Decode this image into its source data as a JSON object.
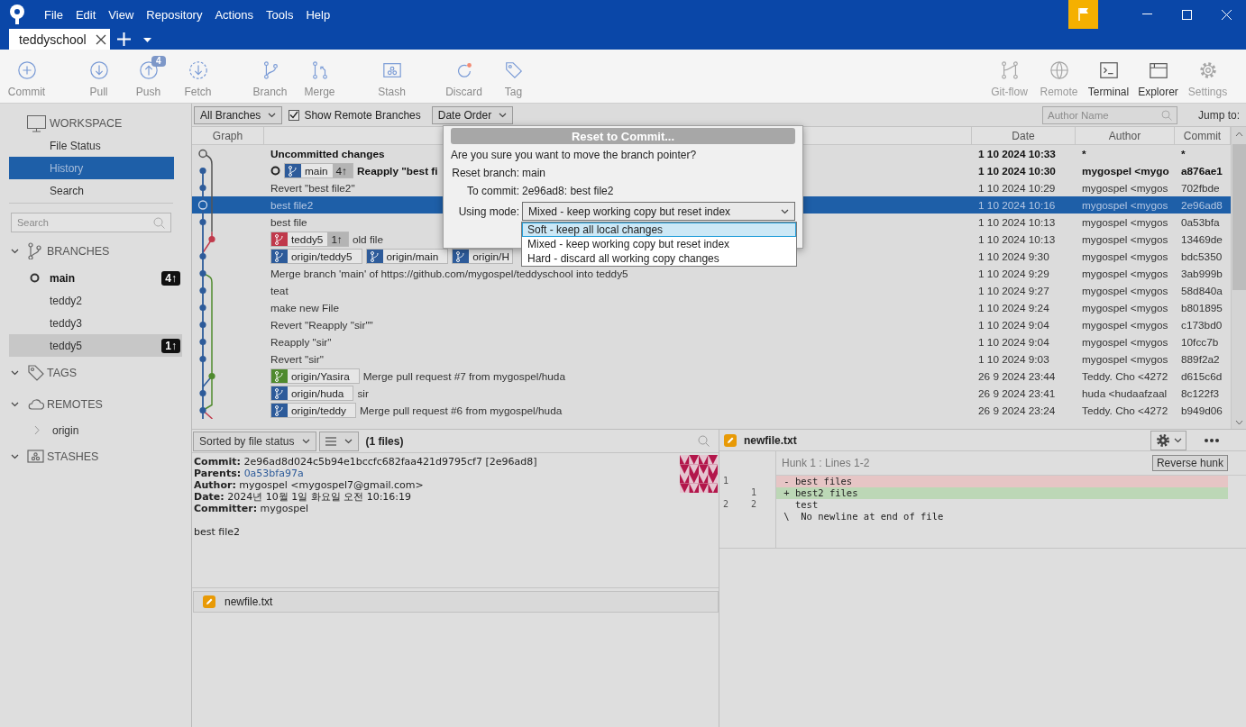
{
  "app": {
    "menu": [
      "File",
      "Edit",
      "View",
      "Repository",
      "Actions",
      "Tools",
      "Help"
    ]
  },
  "tabs": [
    {
      "label": "teddyschool",
      "selected": true
    }
  ],
  "toolbar": {
    "groups": [
      [
        {
          "label": "Commit",
          "kind": "commit"
        }
      ],
      [
        {
          "label": "Pull",
          "kind": "pull"
        },
        {
          "label": "Push",
          "kind": "push",
          "badge": "4"
        },
        {
          "label": "Fetch",
          "kind": "fetch"
        }
      ],
      [
        {
          "label": "Branch",
          "kind": "branch"
        },
        {
          "label": "Merge",
          "kind": "merge"
        }
      ],
      [
        {
          "label": "Stash",
          "kind": "stash"
        }
      ],
      [
        {
          "label": "Discard",
          "kind": "discard"
        },
        {
          "label": "Tag",
          "kind": "tag"
        }
      ]
    ],
    "right": [
      {
        "label": "Git-flow",
        "kind": "gitflow",
        "disabled": true
      },
      {
        "label": "Remote",
        "kind": "remote",
        "disabled": true
      },
      {
        "label": "Terminal",
        "kind": "terminal",
        "disabled": false
      },
      {
        "label": "Explorer",
        "kind": "explorer",
        "disabled": false
      },
      {
        "label": "Settings",
        "kind": "settings",
        "disabled": true
      }
    ]
  },
  "sidebar": {
    "workspace": {
      "title": "WORKSPACE",
      "items": [
        {
          "label": "File Status",
          "selected": false
        },
        {
          "label": "History",
          "selected": true
        },
        {
          "label": "Search",
          "selected": false
        }
      ]
    },
    "search": {
      "placeholder": "Search"
    },
    "sections": [
      {
        "title": "BRANCHES",
        "kind": "branches",
        "items": [
          {
            "label": "main",
            "current": true,
            "selected": false,
            "badge": "4↑"
          },
          {
            "label": "teddy2",
            "current": false,
            "selected": false
          },
          {
            "label": "teddy3",
            "current": false,
            "selected": false
          },
          {
            "label": "teddy5",
            "current": false,
            "selected": true,
            "badge": "1↑"
          }
        ]
      },
      {
        "title": "TAGS",
        "kind": "tags"
      },
      {
        "title": "REMOTES",
        "kind": "remotes",
        "items": [
          {
            "label": "origin",
            "expanded": false
          }
        ]
      },
      {
        "title": "STASHES",
        "kind": "stashes"
      }
    ]
  },
  "filters": {
    "branch_filter": "All Branches",
    "show_remote": {
      "label": "Show Remote Branches",
      "checked": true
    },
    "order": "Date Order",
    "author_search": {
      "placeholder": "Author Name"
    },
    "jump_label": "Jump to:"
  },
  "history": {
    "columns": {
      "graph": "Graph",
      "date": "Date",
      "author": "Author",
      "commit": "Commit"
    },
    "rows": [
      {
        "message": "Uncommitted changes",
        "date": "1 10 2024 10:33",
        "author": "*",
        "commit": "*",
        "bold": true,
        "head": false,
        "selected": false
      },
      {
        "refs": [
          {
            "name": "main",
            "color": "#2d5b9a",
            "ahead": "4↑"
          }
        ],
        "message": "Reapply \"best fi",
        "date": "1 10 2024 10:30",
        "author": "mygospel <mygo",
        "commit": "a876ae1",
        "bold": true,
        "head": true,
        "selected": false
      },
      {
        "message": "Revert \"best file2\"",
        "date": "1 10 2024 10:29",
        "author": "mygospel <mygos",
        "commit": "702fbde",
        "bold": false,
        "head": false,
        "selected": false
      },
      {
        "message": "best file2",
        "date": "1 10 2024 10:16",
        "author": "mygospel <mygos",
        "commit": "2e96ad8",
        "bold": false,
        "head": false,
        "selected": true
      },
      {
        "message": "best file",
        "date": "1 10 2024 10:13",
        "author": "mygospel <mygos",
        "commit": "0a53bfa",
        "bold": false,
        "head": false,
        "selected": false
      },
      {
        "refs": [
          {
            "name": "teddy5",
            "color": "#c0394b",
            "ahead": "1↑"
          }
        ],
        "message": "old file",
        "date": "1 10 2024 10:13",
        "author": "mygospel <mygos",
        "commit": "13469de",
        "bold": false,
        "head": false,
        "selected": false
      },
      {
        "refs": [
          {
            "name": "origin/teddy5",
            "color": "#2d5b9a"
          },
          {
            "name": "origin/main",
            "color": "#2d5b9a"
          },
          {
            "name": "origin/H",
            "color": "#2d5b9a"
          }
        ],
        "date": "1 10 2024 9:30",
        "author": "mygospel <mygos",
        "commit": "bdc5350",
        "bold": false,
        "head": false,
        "selected": false
      },
      {
        "message": "Merge branch 'main' of https://github.com/mygospel/teddyschool into teddy5",
        "date": "1 10 2024 9:29",
        "author": "mygospel <mygos",
        "commit": "3ab999b",
        "bold": false,
        "head": false,
        "selected": false
      },
      {
        "message": "teat",
        "date": "1 10 2024 9:27",
        "author": "mygospel <mygos",
        "commit": "58d840a",
        "bold": false,
        "head": false,
        "selected": false
      },
      {
        "message": "make new File",
        "date": "1 10 2024 9:24",
        "author": "mygospel <mygos",
        "commit": "b801895",
        "bold": false,
        "head": false,
        "selected": false
      },
      {
        "message": "Revert \"Reapply \"sir\"\"",
        "date": "1 10 2024 9:04",
        "author": "mygospel <mygos",
        "commit": "c173bd0",
        "bold": false,
        "head": false,
        "selected": false
      },
      {
        "message": "Reapply \"sir\"",
        "date": "1 10 2024 9:04",
        "author": "mygospel <mygos",
        "commit": "10fcc7b",
        "bold": false,
        "head": false,
        "selected": false
      },
      {
        "message": "Revert \"sir\"",
        "date": "1 10 2024 9:03",
        "author": "mygospel <mygos",
        "commit": "889f2a2",
        "bold": false,
        "head": false,
        "selected": false
      },
      {
        "refs": [
          {
            "name": "origin/Yasira",
            "color": "#4f8a2e"
          }
        ],
        "message": "Merge pull request #7 from mygospel/huda",
        "date": "26 9 2024 23:44",
        "author": "Teddy. Cho <4272",
        "commit": "d615c6d",
        "bold": false,
        "head": false,
        "selected": false
      },
      {
        "refs": [
          {
            "name": "origin/huda",
            "color": "#2d5b9a"
          }
        ],
        "message": "sir",
        "date": "26 9 2024 23:41",
        "author": "huda <hudaafzaal",
        "commit": "8c122f3",
        "bold": false,
        "head": false,
        "selected": false
      },
      {
        "refs": [
          {
            "name": "origin/teddy",
            "color": "#2d5b9a"
          }
        ],
        "message": "Merge pull request #6 from mygospel/huda",
        "date": "26 9 2024 23:24",
        "author": "Teddy. Cho <4272",
        "commit": "b949d06",
        "bold": false,
        "head": false,
        "selected": false
      }
    ]
  },
  "details": {
    "sort": "Sorted by file status",
    "count": "(1 files)",
    "lines": [
      {
        "label": "Commit:",
        "value": "2e96ad8d024c5b94e1bccfc682faa421d9795cf7 [2e96ad8]",
        "kind": "text"
      },
      {
        "label": "Parents:",
        "value": "0a53bfa97a",
        "kind": "link"
      },
      {
        "label": "Author:",
        "value": "mygospel <mygospel7@gmail.com>",
        "kind": "text"
      },
      {
        "label": "Date:",
        "value": "2024년 10월 1일 화요일 오전 10:16:19",
        "kind": "text"
      },
      {
        "label": "Committer:",
        "value": "mygospel",
        "kind": "text"
      }
    ],
    "message": "best file2",
    "files": [
      {
        "name": "newfile.txt"
      }
    ]
  },
  "diff": {
    "file": "newfile.txt",
    "hunk": "Hunk 1 : Lines 1-2",
    "reverse_button": "Reverse hunk",
    "lines": [
      {
        "old": "1",
        "text": " - best files",
        "kind": "removed"
      },
      {
        "new": "1",
        "text": " + best2 files",
        "kind": "added"
      },
      {
        "old": "2",
        "new": "2",
        "text": "   test",
        "kind": "context"
      },
      {
        "text": " \\  No newline at end of file",
        "kind": "context"
      }
    ]
  },
  "dialog": {
    "title": "Reset to Commit...",
    "question": "Are you sure you want to move the branch pointer?",
    "fields": [
      {
        "label": "Reset branch:",
        "value": "main"
      },
      {
        "label": "To commit:",
        "value": "2e96ad8: best file2"
      }
    ],
    "mode": {
      "label": "Using mode:",
      "value": "Mixed - keep working copy but reset index",
      "open": true,
      "options": [
        {
          "label": "Soft - keep all local changes",
          "highlighted": true
        },
        {
          "label": "Mixed - keep working copy but reset index",
          "highlighted": false
        },
        {
          "label": "Hard - discard all working copy changes",
          "highlighted": false
        }
      ]
    }
  }
}
